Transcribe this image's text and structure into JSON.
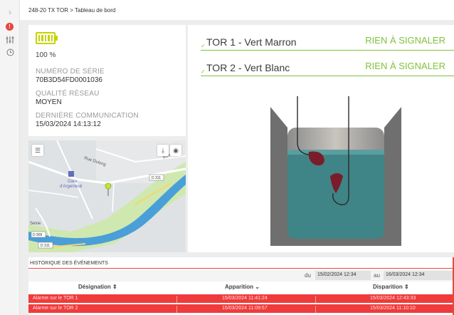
{
  "breadcrumb": "248-20 TX TOR > Tableau de bord",
  "rail": {
    "icons": [
      "chevron-right-icon",
      "alarm-icon",
      "sliders-icon",
      "clock-icon"
    ]
  },
  "device": {
    "battery_percent": "100 %",
    "battery_level": 1.0,
    "serial_label": "NUMÉRO DE SÉRIE",
    "serial_value": "70B3D54FD0001036",
    "network_label": "QUALITÉ RÉSEAU",
    "network_value": "MOYEN",
    "last_comm_label": "DERNIÈRE COMMUNICATION",
    "last_comm_value": "15/03/2024 14:13:12"
  },
  "map": {
    "labels": {
      "rue_dulong": "Rue Dulong",
      "rue_de": "Rue de",
      "gare": "Gare",
      "argenteuil": "d'Argenteuil",
      "seine": "Seine",
      "d311a": "D 311",
      "d311b": "D 311",
      "d909": "D 909"
    }
  },
  "sensors": [
    {
      "name": "TOR 1 - Vert Marron",
      "state": "RIEN À SIGNALER"
    },
    {
      "name": "TOR 2 - Vert Blanc",
      "state": "RIEN À SIGNALER"
    }
  ],
  "events": {
    "title": "HISTORIQUE DES ÉVÉNEMENTS",
    "filter": {
      "du": "du",
      "from": "15/02/2024 12:34",
      "au": "au",
      "to": "16/03/2024 12:34"
    },
    "columns": [
      "Désignation ⇕",
      "Apparition ⌄",
      "Disparition ⇕"
    ],
    "rows": [
      {
        "designation": "Alarme sur le TOR 1",
        "apparition": "15/03/2024 11:41:24",
        "disparition": "15/03/2024 12:43:33"
      },
      {
        "designation": "Alarme sur le TOR 2",
        "apparition": "15/03/2024 11:09:57",
        "disparition": "15/03/2024 11:10:10"
      }
    ]
  },
  "colors": {
    "accent_green": "#7fc33a",
    "battery": "#c6d300",
    "alarm_red": "#ef3b3b",
    "water": "#3f8487"
  }
}
